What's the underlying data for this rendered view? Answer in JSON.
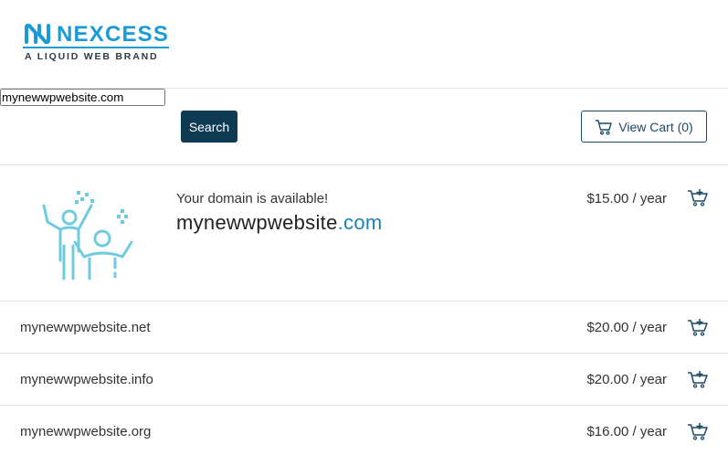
{
  "brand": {
    "name": "NEXCESS",
    "tagline": "A LIQUID WEB BRAND",
    "color": "#1a9ad6"
  },
  "search": {
    "value": "mynewwpwebsite.com",
    "button_label": "Search"
  },
  "cart": {
    "label": "View Cart (0)"
  },
  "featured": {
    "message": "Your domain is available!",
    "domain_base": "mynewwpwebsite",
    "domain_tld": ".com",
    "price": "$15.00 / year"
  },
  "results": [
    {
      "domain": "mynewwpwebsite.net",
      "price": "$20.00 / year"
    },
    {
      "domain": "mynewwpwebsite.info",
      "price": "$20.00 / year"
    },
    {
      "domain": "mynewwpwebsite.org",
      "price": "$16.00 / year"
    }
  ],
  "colors": {
    "accent": "#1a9ad6",
    "button_dark": "#0f3a54",
    "outline": "#1c4a66",
    "illustration": "#6ecbe0"
  }
}
